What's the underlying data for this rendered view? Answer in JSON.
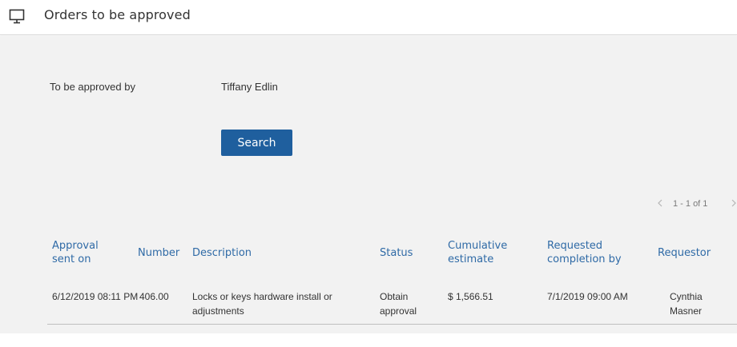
{
  "header": {
    "title": "Orders to be approved",
    "icon": "monitor-icon"
  },
  "filter": {
    "label": "To be approved by",
    "value": "Tiffany Edlin"
  },
  "search_button": {
    "label": "Search",
    "color": "#1f5f9e"
  },
  "pagination": {
    "range": "1 - 1 of 1"
  },
  "table": {
    "columns": [
      "Approval sent on",
      "Number",
      "Description",
      "Status",
      "Cumulative estimate",
      "Requested completion by",
      "Requestor"
    ],
    "rows": [
      {
        "approval_sent_on": "6/12/2019 08:11 PM",
        "number": "406.00",
        "description": "Locks or keys hardware install or adjustments",
        "status": "Obtain approval",
        "cumulative_estimate": "$ 1,566.51",
        "requested_completion_by": "7/1/2019 09:00 AM",
        "requestor": "Cynthia Masner"
      }
    ]
  },
  "colors": {
    "link": "#2f6aa6",
    "panel_background": "#f2f2f2"
  }
}
